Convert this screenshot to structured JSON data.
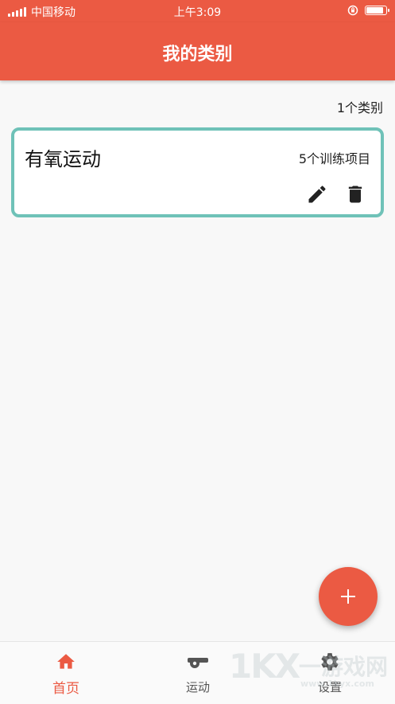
{
  "status_bar": {
    "carrier": "中国移动",
    "time": "上午3:09",
    "battery_level": 0.9
  },
  "app_bar": {
    "title": "我的类别"
  },
  "category_count": "1个类别",
  "categories": [
    {
      "name": "有氧运动",
      "count_label": "5个训练项目",
      "edit_icon": "pencil-icon",
      "delete_icon": "trash-icon"
    }
  ],
  "fab": {
    "icon": "plus-icon"
  },
  "bottom_nav": [
    {
      "label": "首页",
      "icon": "home-icon",
      "active": true
    },
    {
      "label": "运动",
      "icon": "whistle-icon",
      "active": false
    },
    {
      "label": "设置",
      "icon": "gear-icon",
      "active": false
    }
  ],
  "watermark": {
    "mark": "1KX",
    "text": "一游戏网",
    "url": "www.1kyx.com"
  },
  "colors": {
    "primary": "#eb5a43",
    "card_border": "#6fc2b8",
    "background": "#f8f8f8"
  }
}
